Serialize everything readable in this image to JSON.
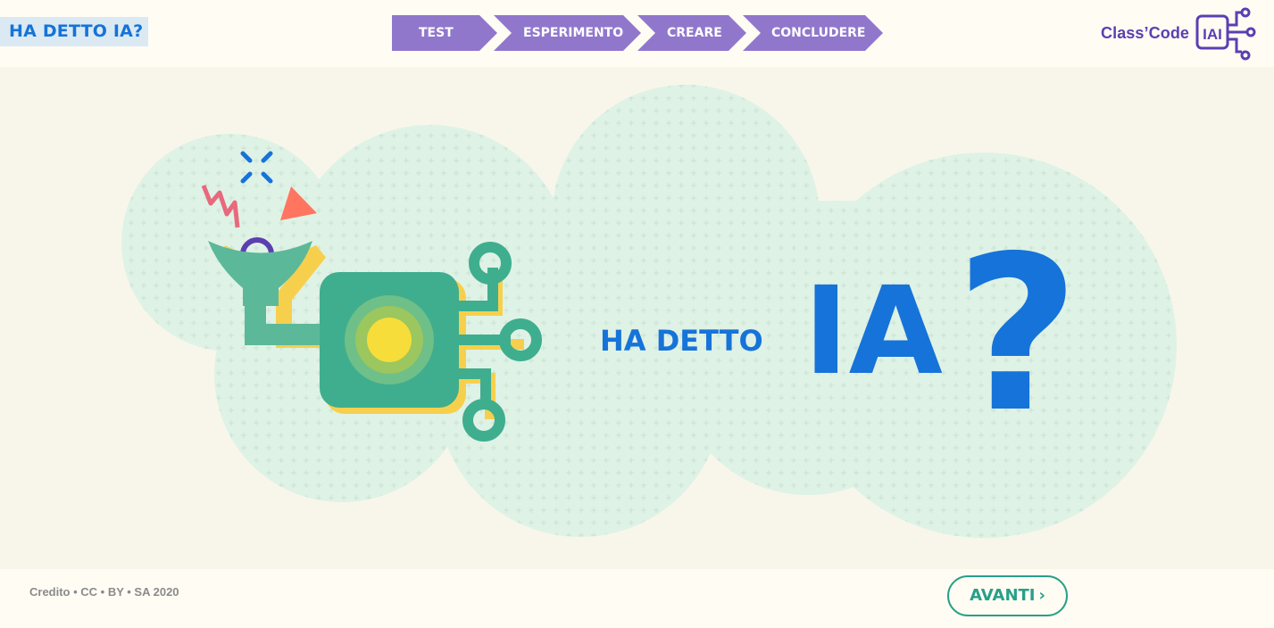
{
  "header": {
    "app_title": "HA DETTO IA?",
    "steps": [
      {
        "label": "TEST"
      },
      {
        "label": "ESPERIMENTO"
      },
      {
        "label": "CREARE"
      },
      {
        "label": "CONCLUDERE"
      }
    ],
    "logo_text": "Class’Code",
    "logo_badge": "IAI"
  },
  "hero": {
    "subtitle": "HA DETTO",
    "title": "IA",
    "question_mark": "?"
  },
  "footer": {
    "credit": "Credito • CC • BY • SA 2020",
    "next_label": "AVANTI",
    "next_chevron": "›"
  },
  "colors": {
    "accent_blue": "#1673d9",
    "step_purple": "#9077cc",
    "logo_purple": "#5b3fb1",
    "teal": "#27a088",
    "cloud_green": "#dff2e6"
  },
  "icons": [
    "chevron-right-icon",
    "robot-funnel-illustration",
    "class-code-circuit-icon"
  ]
}
